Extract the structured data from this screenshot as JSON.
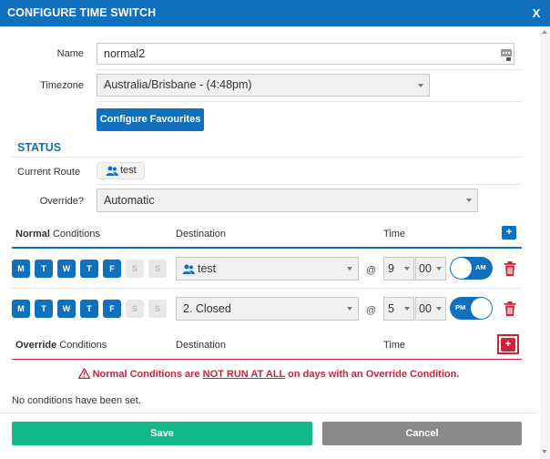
{
  "dialog": {
    "title": "CONFIGURE TIME SWITCH",
    "close_label": "X"
  },
  "form": {
    "name_label": "Name",
    "name_value": "normal2",
    "timezone_label": "Timezone",
    "timezone_value": "Australia/Brisbane - (4:48pm)",
    "configure_favourites_label": "Configure Favourites"
  },
  "status": {
    "title": "STATUS",
    "current_route_label": "Current Route",
    "current_route_value": "test",
    "override_label": "Override?",
    "override_value": "Automatic"
  },
  "normal": {
    "heading_bold": "Normal",
    "heading_rest": " Conditions",
    "destination_header": "Destination",
    "time_header": "Time",
    "add_label": "+",
    "rows": [
      {
        "days": [
          {
            "label": "M",
            "active": true
          },
          {
            "label": "T",
            "active": true
          },
          {
            "label": "W",
            "active": true
          },
          {
            "label": "T",
            "active": true
          },
          {
            "label": "F",
            "active": true
          },
          {
            "label": "S",
            "active": false
          },
          {
            "label": "S",
            "active": false
          }
        ],
        "destination": "test",
        "at": "@",
        "hour": "9",
        "minute": "00",
        "ampm": "AM"
      },
      {
        "days": [
          {
            "label": "M",
            "active": true
          },
          {
            "label": "T",
            "active": true
          },
          {
            "label": "W",
            "active": true
          },
          {
            "label": "T",
            "active": true
          },
          {
            "label": "F",
            "active": true
          },
          {
            "label": "S",
            "active": false
          },
          {
            "label": "S",
            "active": false
          }
        ],
        "destination": "2. Closed",
        "at": "@",
        "hour": "5",
        "minute": "00",
        "ampm": "PM"
      }
    ]
  },
  "override": {
    "heading_bold": "Override",
    "heading_rest": " Conditions",
    "destination_header": "Destination",
    "time_header": "Time",
    "add_label": "+",
    "warning_pre": "Normal Conditions are ",
    "warning_underlined": "NOT RUN AT ALL",
    "warning_post": " on days with an Override Condition.",
    "empty_message": "No conditions have been set."
  },
  "footer": {
    "save_label": "Save",
    "cancel_label": "Cancel"
  },
  "colors": {
    "accent": "#1170bd",
    "save": "#12b886",
    "cancel": "#8a8a8a",
    "danger": "#d0223a"
  }
}
